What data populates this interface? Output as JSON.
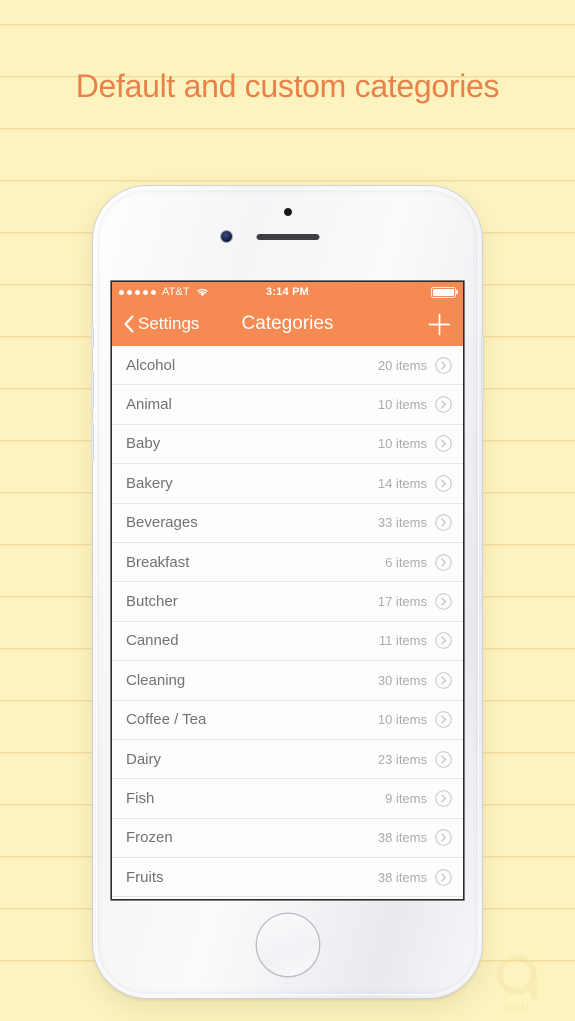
{
  "page": {
    "headline": "Default and custom categories",
    "background_color": "#fdf3bf",
    "accent_color": "#f58a52",
    "headline_color": "#e8824a"
  },
  "status_bar": {
    "carrier": "AT&T",
    "time": "3:14 PM",
    "signal_dots": 5,
    "wifi_icon": "wifi-icon",
    "battery_icon": "battery-full-icon"
  },
  "nav_bar": {
    "back_label": "Settings",
    "back_icon": "chevron-left-icon",
    "title": "Categories",
    "add_icon": "plus-icon"
  },
  "list": {
    "count_suffix": "items",
    "disclosure_icon": "chevron-right-circle-icon",
    "rows": [
      {
        "name": "Alcohol",
        "count": "20 items"
      },
      {
        "name": "Animal",
        "count": "10 items"
      },
      {
        "name": "Baby",
        "count": "10 items"
      },
      {
        "name": "Bakery",
        "count": "14 items"
      },
      {
        "name": "Beverages",
        "count": "33 items"
      },
      {
        "name": "Breakfast",
        "count": "6 items"
      },
      {
        "name": "Butcher",
        "count": "17 items"
      },
      {
        "name": "Canned",
        "count": "11 items"
      },
      {
        "name": "Cleaning",
        "count": "30 items"
      },
      {
        "name": "Coffee / Tea",
        "count": "10 items"
      },
      {
        "name": "Dairy",
        "count": "23 items"
      },
      {
        "name": "Fish",
        "count": "9 items"
      },
      {
        "name": "Frozen",
        "count": "38 items"
      },
      {
        "name": "Fruits",
        "count": "38 items"
      },
      {
        "name": "",
        "count": ""
      }
    ]
  },
  "watermark": {
    "text": "app"
  }
}
